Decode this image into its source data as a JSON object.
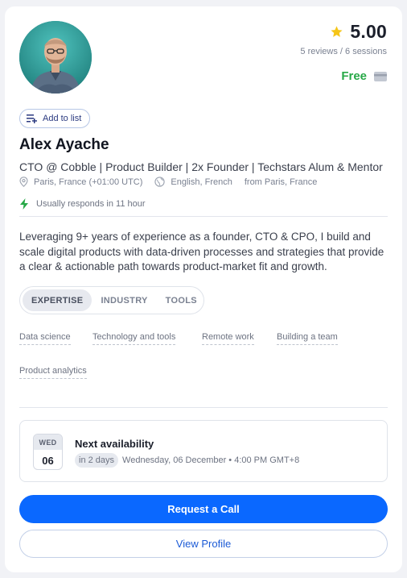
{
  "profile": {
    "name": "Alex Ayache",
    "headline": "CTO @ Cobble | Product Builder | 2x Founder | Techstars Alum & Mentor",
    "location": "Paris, France (+01:00 UTC)",
    "languages": "English, French",
    "origin": "from Paris, France",
    "response_time": "Usually responds in 11 hour",
    "bio": "Leveraging 9+ years of experience as a founder, CTO & CPO, I build and scale digital products with data-driven processes and strategies that provide a clear & actionable path towards product-market fit and growth."
  },
  "rating": {
    "value": "5.00",
    "summary": "5 reviews / 6 sessions"
  },
  "pricing": {
    "label": "Free"
  },
  "actions": {
    "add_to_list": "Add to list",
    "request_call": "Request a Call",
    "view_profile": "View Profile"
  },
  "tabs": [
    {
      "label": "EXPERTISE",
      "active": true
    },
    {
      "label": "INDUSTRY",
      "active": false
    },
    {
      "label": "TOOLS",
      "active": false
    }
  ],
  "expertise_tags": [
    "Data science",
    "Technology and tools",
    "Remote work",
    "Building a team",
    "Product analytics"
  ],
  "availability": {
    "weekday": "WED",
    "date": "06",
    "title": "Next availability",
    "relative": "in 2 days",
    "detail": "Wednesday, 06 December • 4:00 PM GMT+8"
  },
  "colors": {
    "primary": "#0a68ff",
    "free_green": "#27a847",
    "star": "#f5c518",
    "bolt": "#27a847"
  },
  "icons": {
    "rating": "star-icon",
    "pricing": "credit-card-icon",
    "add_to_list": "list-add-icon",
    "location": "map-pin-icon",
    "language": "globe-icon",
    "response": "lightning-icon"
  }
}
